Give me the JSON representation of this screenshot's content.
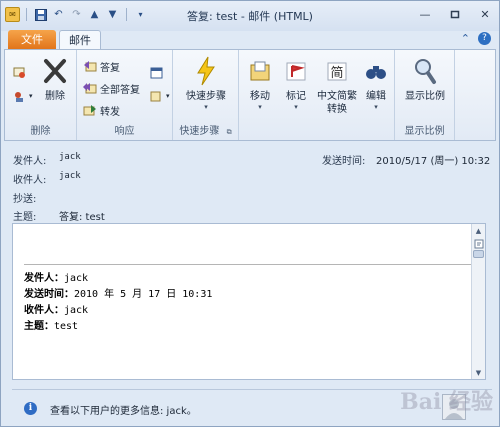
{
  "window": {
    "title": "答复: test - 邮件 (HTML)"
  },
  "quick_access": {
    "icons": [
      "outlook-icon",
      "save-icon",
      "undo-icon",
      "redo-icon",
      "up-icon",
      "down-icon",
      "customize-icon"
    ]
  },
  "tabs": {
    "file": "文件",
    "mail": "邮件"
  },
  "ribbon": {
    "delete_group": {
      "label": "删除",
      "delete": "删除"
    },
    "respond_group": {
      "label": "响应",
      "reply": "答复",
      "reply_all": "全部答复",
      "forward": "转发"
    },
    "quicksteps_group": {
      "label": "快速步骤",
      "quicksteps": "快速步骤"
    },
    "move": "移动",
    "tags": "标记",
    "chinese": "中文简繁\n转换",
    "edit": "编辑",
    "zoom_group": {
      "label": "显示比例",
      "zoom": "显示比例"
    }
  },
  "header": {
    "from_label": "发件人:",
    "from_value": "jack",
    "to_label": "收件人:",
    "to_value": "jack",
    "cc_label": "抄送:",
    "subject_label": "主题:",
    "subject_value": "答复: test",
    "sent_label": "发送时间:",
    "sent_value": "2010/5/17 (周一) 10:32"
  },
  "body": {
    "from_key": "发件人：",
    "from_val": "jack",
    "sent_key": "发送时间：",
    "sent_val": "2010 年 5 月 17 日 10:31",
    "to_key": "收件人：",
    "to_val": "jack",
    "subject_key": "主题：",
    "subject_val": "test"
  },
  "people_pane": {
    "text": "查看以下用户的更多信息: jack。"
  },
  "watermark": "Bai 经验"
}
